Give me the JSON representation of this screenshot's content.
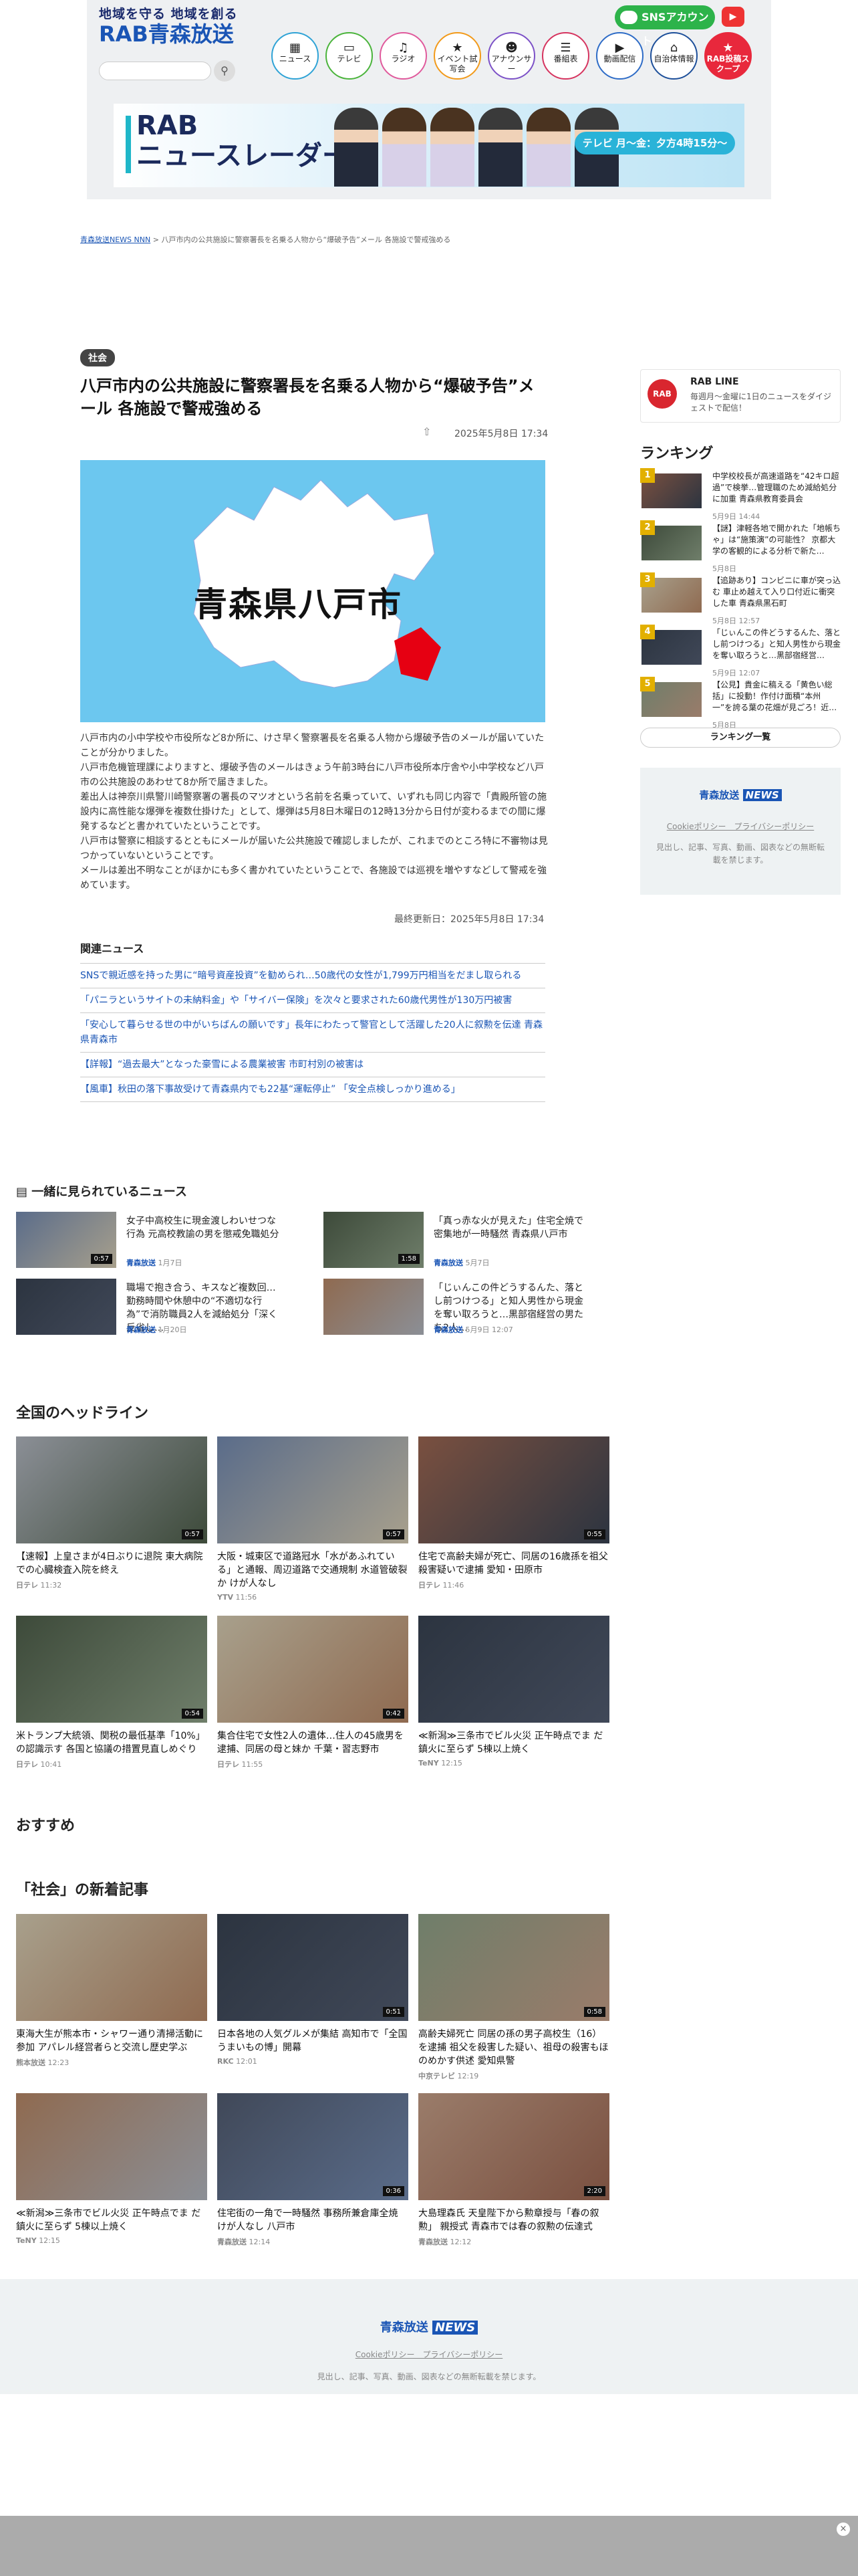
{
  "header": {
    "tagline": "地域を守る 地域を創る",
    "logo": "RAB青森放送",
    "search_placeholder": "",
    "sns_label": "SNSアカウント",
    "youtube_icon": "youtube-icon",
    "nav": [
      {
        "label": "ニュース",
        "icon": "news-icon"
      },
      {
        "label": "テレビ",
        "icon": "tv-icon"
      },
      {
        "label": "ラジオ",
        "icon": "radio-icon"
      },
      {
        "label": "イベント試写会",
        "icon": "event-icon"
      },
      {
        "label": "アナウンサー",
        "icon": "announcer-icon"
      },
      {
        "label": "番組表",
        "icon": "schedule-icon"
      },
      {
        "label": "動画配信",
        "icon": "video-icon"
      },
      {
        "label": "自治体情報",
        "icon": "city-icon"
      },
      {
        "label": "RAB投稿スクープ",
        "icon": "scoop-icon"
      }
    ]
  },
  "banner": {
    "line1": "RAB",
    "line2": "ニュースレーダー",
    "schedule": "テレビ 月〜金：夕方4時15分〜"
  },
  "breadcrumb": {
    "home": "青森放送NEWS NNN",
    "sep": ">",
    "current": "八戸市内の公共施設に警察署長を名乗る人物から“爆破予告”メール 各施設で警戒強める"
  },
  "article": {
    "category": "社会",
    "title": "八戸市内の公共施設に警察署長を名乗る人物から“爆破予告”メール 各施設で警戒強める",
    "published": "2025年5月8日 17:34",
    "hero_text": "青森県八戸市",
    "body": [
      "八戸市内の小中学校や市役所など8か所に、けさ早く警察署長を名乗る人物から爆破予告のメールが届いていたことが分かりました。",
      "八戸市危機管理課によりますと、爆破予告のメールはきょう午前3時台に八戸市役所本庁舎や小中学校など八戸市の公共施設のあわせて8か所で届きました。",
      "差出人は神奈川県警川崎警察署の署長のマツオという名前を名乗っていて、いずれも同じ内容で「貴殿所管の施設内に高性能な爆弾を複数仕掛けた」として、爆弾は5月8日木曜日の12時13分から日付が変わるまでの間に爆発するなどと書かれていたということです。",
      "八戸市は警察に相談するとともにメールが届いた公共施設で確認しましたが、これまでのところ特に不審物は見つかっていないということです。",
      "メールは差出不明なことがほかにも多く書かれていたということで、各施設では巡視を増やすなどして警戒を強めています。"
    ],
    "updated": "最終更新日：2025年5月8日 17:34",
    "related_heading": "関連ニュース",
    "related": [
      "SNSで親近感を持った男に“暗号資産投資”を勧められ…50歳代の女性が1,799万円相当をだまし取られる",
      "「パニラというサイトの未納料金」や「サイバー保険」を次々と要求された60歳代男性が130万円被害",
      "「安心して暮らせる世の中がいちばんの願いです」長年にわたって警官として活躍した20人に叙勲を伝達 青森県青森市",
      "【詳報】“過去最大”となった豪雪による農業被害 市町村別の被害は",
      "【風車】秋田の落下事故受けて青森県内でも22基“運転停止” 「安全点検しっかり進める」"
    ]
  },
  "sidebar": {
    "line_title": "RAB LINE",
    "line_sub": "毎週月〜金曜に1日のニュースをダイジェストで配信！",
    "ranking_heading": "ランキング",
    "ranking": [
      {
        "num": "1",
        "text": "中学校校長が高速道路を“42キロ超過”で検挙…管理職のため減給処分に加重 青森県教育委員会",
        "date": "5月9日 14:44"
      },
      {
        "num": "2",
        "text": "【謎】津軽各地で開かれた「地帳ちゃ」は“施策演”の可能性？ 京都大学の客観的による分析で新た…",
        "date": "5月8日"
      },
      {
        "num": "3",
        "text": "【追跡あり】コンビニに車が突っ込む 車止め越えて入り口付近に衝突した車 青森県黒石町",
        "date": "5月8日 12:57"
      },
      {
        "num": "4",
        "text": "「じぃんこの件どうするんた、落とし前つけつる」と知人男性から現金を奪い取ろうと…黒部宿経営…",
        "date": "5月9日 12:07"
      },
      {
        "num": "5",
        "text": "【公見】貴金に稿える「黄色い総括」に投動！作付け面積“本州一”を誇る葉の花畑が見ごろ！近…",
        "date": "5月8日"
      }
    ],
    "ranking_more": "ランキング一覧",
    "footer_logo_a": "青森放送",
    "footer_logo_b": "NEWS",
    "footer_links": "Cookieポリシー　プライバシーポリシー",
    "footer_copy": "見出し、記事、写真、動画、図表などの無断転載を禁じます。"
  },
  "also_read": {
    "heading": "一緒に見られているニュース",
    "items": [
      {
        "text": "女子中高校生に現金渡しわいせつな行為 元高校教諭の男を懲戒免職処分",
        "src": "青森放送",
        "date": "1月7日",
        "dur": "0:57"
      },
      {
        "text": "「真っ赤な火が見えた」住宅全焼で密集地が一時騒然 青森県八戸市",
        "src": "青森放送",
        "date": "5月7日",
        "dur": "1:58"
      },
      {
        "text": "職場で抱き合う、キスなど複数回…勤務時間や休憩中の“不適切な行為”で消防職員2人を減給処分「深く反省し…",
        "src": "青森放送",
        "date": "1月20日",
        "dur": ""
      },
      {
        "text": "「じぃんこの件どうするんた、落とし前つけつる」と知人男性から現金を奪い取ろうと…黒部宿経営の男たち2人…",
        "src": "青森放送",
        "date": "5月9日 12:07",
        "dur": ""
      }
    ]
  },
  "headlines": {
    "heading": "全国のヘッドライン",
    "items": [
      {
        "text": "【速報】上皇さまが4日ぶりに退院 東大病院での心臓検査入院を終え",
        "src": "日テレ",
        "time": "11:32",
        "dur": "0:57"
      },
      {
        "text": "大阪・城東区で道路冠水「水があふれている」と通報、周辺道路で交通規制 水道管破裂か けが人なし",
        "src": "YTV",
        "time": "11:56",
        "dur": "0:57"
      },
      {
        "text": "住宅で高齢夫婦が死亡、同居の16歳孫を祖父殺害疑いで逮捕 愛知・田原市",
        "src": "日テレ",
        "time": "11:46",
        "dur": "0:55"
      },
      {
        "text": "米トランプ大統領、関税の最低基準「10%」の認識示す 各国と協議の措置見直しめぐり",
        "src": "日テレ",
        "time": "10:41",
        "dur": "0:54"
      },
      {
        "text": "集合住宅で女性2人の遺体…住人の45歳男を逮捕、同居の母と妹か 千葉・習志野市",
        "src": "日テレ",
        "time": "11:55",
        "dur": "0:42"
      },
      {
        "text": "≪新潟≫三条市でビル火災 正午時点でま だ鎮火に至らず 5棟以上焼く",
        "src": "TeNY",
        "time": "12:15",
        "dur": ""
      }
    ]
  },
  "recommend": {
    "heading": "おすすめ"
  },
  "social": {
    "heading": "「社会」の新着記事",
    "items": [
      {
        "text": "東海大生が熊本市・シャワー通り清掃活動に参加 アパレル経営者らと交流し歴史学ぶ",
        "src": "熊本放送",
        "time": "12:23",
        "dur": ""
      },
      {
        "text": "日本各地の人気グルメが集結 高知市で「全国うまいもの博」開幕",
        "src": "RKC",
        "time": "12:01",
        "dur": "0:51"
      },
      {
        "text": "高齢夫婦死亡 同居の孫の男子高校生（16）を逮捕 祖父を殺害した疑い、祖母の殺害もほのめかす供述 愛知県警",
        "src": "中京テレビ",
        "time": "12:19",
        "dur": "0:58"
      },
      {
        "text": "≪新潟≫三条市でビル火災 正午時点でま だ鎮火に至らず 5棟以上焼く",
        "src": "TeNY",
        "time": "12:15",
        "dur": ""
      },
      {
        "text": "住宅街の一角で一時騒然 事務所兼倉庫全焼 けが人なし 八戸市",
        "src": "青森放送",
        "time": "12:14",
        "dur": "0:36"
      },
      {
        "text": "大島理森氏 天皇陛下から勲章授与「春の叙勲」 親授式 青森市では春の叙勲の伝達式",
        "src": "青森放送",
        "time": "12:12",
        "dur": "2:20"
      }
    ]
  },
  "footer": {
    "logo_a": "青森放送",
    "logo_b": "NEWS",
    "links": "Cookieポリシー　プライバシーポリシー",
    "copy": "見出し、記事、写真、動画、図表などの無断転載を禁じます。"
  },
  "ad": {
    "close": "×"
  },
  "colors": {
    "brand": "#1a55b5",
    "link": "#1a55b5",
    "accent_red": "#e8283c",
    "hero_bg": "#6cc7ef",
    "footer_bg": "#eef2f3"
  }
}
